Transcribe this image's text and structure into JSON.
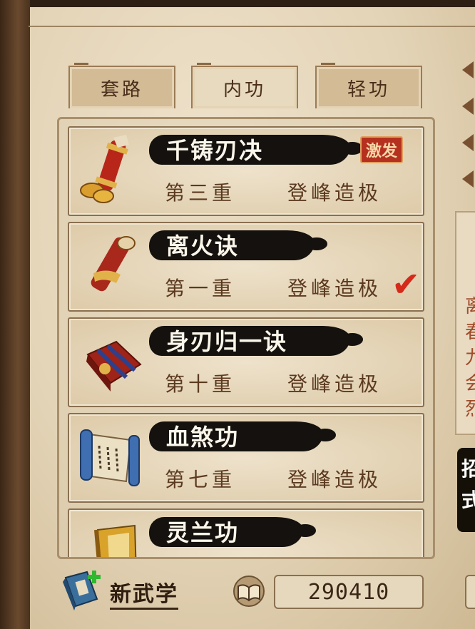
{
  "tabs": [
    {
      "label": "套路",
      "active": false
    },
    {
      "label": "内功",
      "active": true
    },
    {
      "label": "轻功",
      "active": false
    }
  ],
  "skills": [
    {
      "name": "千铸刃决",
      "level": "第三重",
      "rank": "登峰造极",
      "badge": "激发",
      "icon": "red-scroll-with-coins-icon"
    },
    {
      "name": "离火诀",
      "level": "第一重",
      "rank": "登峰造极",
      "selected": true,
      "icon": "red-scroll-icon"
    },
    {
      "name": "身刃归一诀",
      "level": "第十重",
      "rank": "登峰造极",
      "icon": "red-tied-book-icon"
    },
    {
      "name": "血煞功",
      "level": "第七重",
      "rank": "登峰造极",
      "icon": "blue-scroll-icon"
    },
    {
      "name": "灵兰功",
      "icon": "yellow-book-icon"
    }
  ],
  "side_panel": {
    "chars": [
      "离",
      "春",
      "九",
      "会",
      "烈"
    ]
  },
  "side_tab": {
    "chars": [
      "招",
      "式"
    ]
  },
  "bottom": {
    "new_label": "新武学",
    "points": "290410"
  },
  "colors": {
    "ink": "#14110e",
    "paper": "#e3d3b6",
    "accent_red": "#b5301f"
  }
}
